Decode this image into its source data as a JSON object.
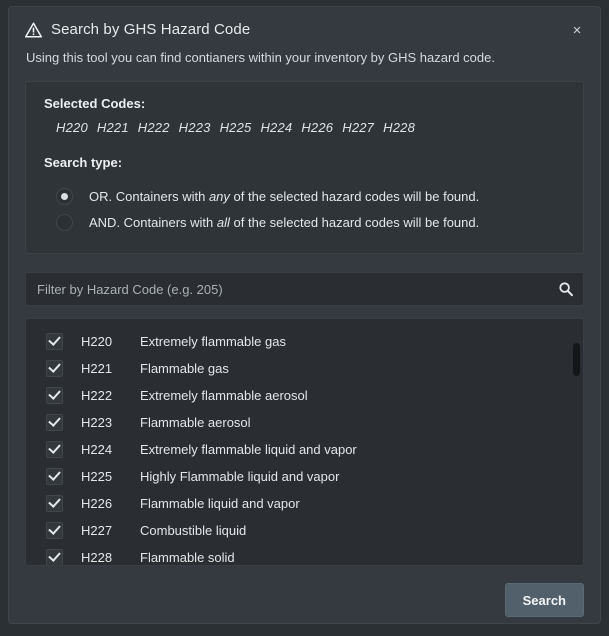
{
  "modal": {
    "title": "Search by GHS Hazard Code",
    "warning_icon": "warning-triangle-icon",
    "close_label": "×",
    "subtitle": "Using this tool you can find contianers within your inventory by GHS hazard code."
  },
  "selected": {
    "label": "Selected Codes:",
    "codes": [
      "H220",
      "H221",
      "H222",
      "H223",
      "H225",
      "H224",
      "H226",
      "H227",
      "H228"
    ]
  },
  "search_type": {
    "label": "Search type:",
    "options": [
      {
        "id": "or",
        "text_before": "OR. Containers with ",
        "emphasis": "any",
        "text_after": " of the selected hazard codes will be found.",
        "selected": true
      },
      {
        "id": "and",
        "text_before": "AND. Containers with ",
        "emphasis": "all",
        "text_after": " of the selected hazard codes will be found.",
        "selected": false
      }
    ]
  },
  "filter": {
    "placeholder": "Filter by Hazard Code (e.g. 205)",
    "value": "",
    "icon": "search-icon"
  },
  "code_list": {
    "rows": [
      {
        "code": "H220",
        "description": "Extremely flammable gas",
        "checked": true
      },
      {
        "code": "H221",
        "description": "Flammable gas",
        "checked": true
      },
      {
        "code": "H222",
        "description": "Extremely flammable aerosol",
        "checked": true
      },
      {
        "code": "H223",
        "description": "Flammable aerosol",
        "checked": true
      },
      {
        "code": "H224",
        "description": "Extremely flammable liquid and vapor",
        "checked": true
      },
      {
        "code": "H225",
        "description": "Highly Flammable liquid and vapor",
        "checked": true
      },
      {
        "code": "H226",
        "description": "Flammable liquid and vapor",
        "checked": true
      },
      {
        "code": "H227",
        "description": "Combustible liquid",
        "checked": true
      },
      {
        "code": "H228",
        "description": "Flammable solid",
        "checked": true
      }
    ]
  },
  "footer": {
    "search_label": "Search"
  },
  "colors": {
    "modal_background": "#343a40",
    "panel_background": "#2f3438",
    "field_background": "#2a2e33",
    "button_background": "#51606a",
    "text": "#e3e7ea",
    "warning_icon": "#f8f9fa"
  }
}
